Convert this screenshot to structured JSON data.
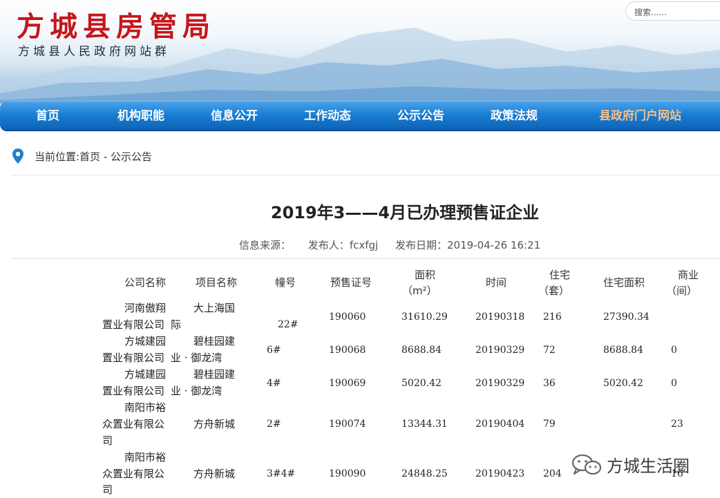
{
  "header": {
    "title": "方城县房管局",
    "subtitle": "方城县人民政府网站群",
    "search_placeholder": "搜索......"
  },
  "nav": {
    "items": [
      {
        "label": "首页"
      },
      {
        "label": "机构职能"
      },
      {
        "label": "信息公开"
      },
      {
        "label": "工作动态"
      },
      {
        "label": "公示公告"
      },
      {
        "label": "政策法规"
      },
      {
        "label": "县政府门户网站"
      }
    ]
  },
  "breadcrumb": {
    "text": "当前位置:首页 - 公示公告"
  },
  "article": {
    "title": "2019年3——4月已办理预售证企业",
    "meta": {
      "source_label": "信息来源：",
      "publisher_label": "发布人：",
      "publisher": "fcxfgj",
      "date_label": "发布日期：",
      "date": "2019-04-26 16:21"
    }
  },
  "table": {
    "headers": {
      "company": "公司名称",
      "project": "项目名称",
      "building": "幢号",
      "permit": "预售证号",
      "area_1": "面积",
      "area_2": "（m²）",
      "time": "时间",
      "res_1": "住宅",
      "res_2": "（套）",
      "res_area": "住宅面积",
      "biz_1": "商业",
      "biz_2": "（间）"
    },
    "rows": [
      {
        "company_1": "河南傲翔",
        "company_2": "置业有限公司",
        "project_1": "大上海国",
        "project_2": "际",
        "building": "22#",
        "permit": "190060",
        "area": "31610.29",
        "time": "20190318",
        "res": "216",
        "res_area": "27390.34",
        "biz": ""
      },
      {
        "company_1": "方城建园",
        "company_2": "置业有限公司",
        "project_1": "碧桂园建",
        "project_2": "业 · 御龙湾",
        "building": "6#",
        "permit": "190068",
        "area": "8688.84",
        "time": "20190329",
        "res": "72",
        "res_area": "8688.84",
        "biz": "0"
      },
      {
        "company_1": "方城建园",
        "company_2": "置业有限公司",
        "project_1": "碧桂园建",
        "project_2": "业 · 御龙湾",
        "building": "4#",
        "permit": "190069",
        "area": "5020.42",
        "time": "20190329",
        "res": "36",
        "res_area": "5020.42",
        "biz": "0"
      },
      {
        "company_1": "南阳市裕",
        "company_2": "众置业有限公",
        "company_3": "司",
        "project": "方舟新城",
        "building": "2#",
        "permit": "190074",
        "area": "13344.31",
        "time": "20190404",
        "res": "79",
        "res_area": "",
        "biz": "23"
      },
      {
        "company_1": "南阳市裕",
        "company_2": "众置业有限公",
        "company_3": "司",
        "project": "方舟新城",
        "building": "3#4#",
        "permit": "190090",
        "area": "24848.25",
        "time": "20190423",
        "res": "204",
        "res_area": "",
        "biz": "16"
      }
    ]
  },
  "watermark": {
    "text": "方城生活圈"
  }
}
